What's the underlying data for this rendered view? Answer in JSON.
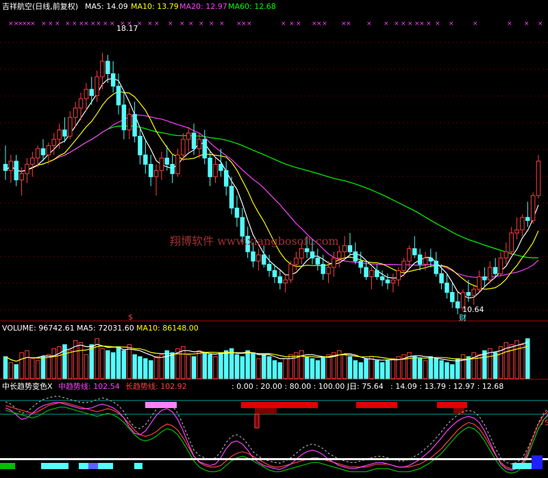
{
  "header": {
    "title": "吉祥航空(日线,前复权)",
    "ma5_label": "MA5: 14.09",
    "ma10_label": "MA10: 13.79",
    "ma20_label": "MA20: 12.97",
    "ma60_label": "MA60: 12.68"
  },
  "annotations": {
    "high": "18.17",
    "low": "10.64",
    "low_marker": "财",
    "dollar_marker": "$",
    "watermark": "翔博软件 www.xiangbosoft.com"
  },
  "volume_header": {
    "volume_label": "VOLUME: 96742.61",
    "ma5_label": "MA5: 72031.60",
    "ma10_label": "MA10: 86148.00"
  },
  "indicator_header": {
    "name": "中长趋势变色X",
    "mid_label": "中趋势线: 102.54",
    "long_label": "长趋势线: 102.92",
    "extra": ": 0.00 : 20.00 : 80.00 : 100.00 J日: 75.64",
    "ma_values": ": 14.09 : 13.79 : 12.97 : 12.68"
  },
  "indicator_edge_label": "75",
  "colors": {
    "background": "#000000",
    "up": "#ff4040",
    "down": "#54fcfc",
    "ma5": "#ffffff",
    "ma10": "#ffff00",
    "ma20": "#ff40ff",
    "ma60": "#00ff00",
    "separator": "#c00000",
    "header_text": "#ffffff",
    "mid_trend": "#ff40ff",
    "long_trend": "#ff4040"
  },
  "chart_data": [
    {
      "type": "candlestick",
      "panel": "price",
      "ylim": [
        10.2,
        19.2
      ],
      "high_marker": 18.17,
      "low_marker": 10.64,
      "candles": [
        [
          14.6,
          15.2,
          14.1,
          14.4
        ],
        [
          14.4,
          14.9,
          14.0,
          14.7
        ],
        [
          14.7,
          14.9,
          13.9,
          14.1
        ],
        [
          14.1,
          14.5,
          13.6,
          14.3
        ],
        [
          14.3,
          14.8,
          14.0,
          14.6
        ],
        [
          14.6,
          15.0,
          14.2,
          14.8
        ],
        [
          14.8,
          15.2,
          14.5,
          15.1
        ],
        [
          15.1,
          15.4,
          14.7,
          14.9
        ],
        [
          14.9,
          15.3,
          14.6,
          15.2
        ],
        [
          15.2,
          15.6,
          14.9,
          15.4
        ],
        [
          15.4,
          15.9,
          15.1,
          15.7
        ],
        [
          15.7,
          16.1,
          15.3,
          15.5
        ],
        [
          15.5,
          16.3,
          15.4,
          16.1
        ],
        [
          16.1,
          16.6,
          15.8,
          16.4
        ],
        [
          16.4,
          16.9,
          16.0,
          16.7
        ],
        [
          16.7,
          17.2,
          16.3,
          17.0
        ],
        [
          17.0,
          17.4,
          16.5,
          16.8
        ],
        [
          16.8,
          17.6,
          16.6,
          17.4
        ],
        [
          17.4,
          18.17,
          17.0,
          17.9
        ],
        [
          17.9,
          18.1,
          17.2,
          17.5
        ],
        [
          17.5,
          17.9,
          16.9,
          17.1
        ],
        [
          17.1,
          17.5,
          16.2,
          16.5
        ],
        [
          16.5,
          16.9,
          15.4,
          15.7
        ],
        [
          15.7,
          16.4,
          15.4,
          16.2
        ],
        [
          16.2,
          16.6,
          15.3,
          15.5
        ],
        [
          15.5,
          15.8,
          14.6,
          14.9
        ],
        [
          14.9,
          15.4,
          14.3,
          14.6
        ],
        [
          14.6,
          14.9,
          13.9,
          14.2
        ],
        [
          14.2,
          14.6,
          13.6,
          14.4
        ],
        [
          14.4,
          15.0,
          14.1,
          14.8
        ],
        [
          14.8,
          15.2,
          14.4,
          14.6
        ],
        [
          14.6,
          14.9,
          14.0,
          14.3
        ],
        [
          14.3,
          15.1,
          14.2,
          14.9
        ],
        [
          14.9,
          15.6,
          14.7,
          15.4
        ],
        [
          15.4,
          15.8,
          15.0,
          15.6
        ],
        [
          15.6,
          15.9,
          14.9,
          15.1
        ],
        [
          15.1,
          15.6,
          14.8,
          15.4
        ],
        [
          15.4,
          15.7,
          14.6,
          14.8
        ],
        [
          14.8,
          15.0,
          13.9,
          14.2
        ],
        [
          14.2,
          14.8,
          14.0,
          14.6
        ],
        [
          14.6,
          15.1,
          14.2,
          14.4
        ],
        [
          14.4,
          14.7,
          13.6,
          13.9
        ],
        [
          13.9,
          14.2,
          13.0,
          13.2
        ],
        [
          13.2,
          13.6,
          12.6,
          12.9
        ],
        [
          12.9,
          13.2,
          12.1,
          12.3
        ],
        [
          12.3,
          12.6,
          11.6,
          11.8
        ],
        [
          11.8,
          12.1,
          11.3,
          11.5
        ],
        [
          11.5,
          11.9,
          11.2,
          11.7
        ],
        [
          11.7,
          12.0,
          11.3,
          11.4
        ],
        [
          11.4,
          11.7,
          11.0,
          11.2
        ],
        [
          11.2,
          11.4,
          10.8,
          11.0
        ],
        [
          11.0,
          11.2,
          10.6,
          10.8
        ],
        [
          10.8,
          11.1,
          10.5,
          10.9
        ],
        [
          10.9,
          11.5,
          10.8,
          11.4
        ],
        [
          11.4,
          11.8,
          11.2,
          11.6
        ],
        [
          11.6,
          12.1,
          11.4,
          11.9
        ],
        [
          11.9,
          12.3,
          11.6,
          11.8
        ],
        [
          11.8,
          12.2,
          11.4,
          11.6
        ],
        [
          11.6,
          11.9,
          11.2,
          11.4
        ],
        [
          11.4,
          11.7,
          10.9,
          11.1
        ],
        [
          11.1,
          11.5,
          10.8,
          11.3
        ],
        [
          11.3,
          11.8,
          11.0,
          11.6
        ],
        [
          11.6,
          12.0,
          11.3,
          11.8
        ],
        [
          11.8,
          12.3,
          11.6,
          12.0
        ],
        [
          12.0,
          12.4,
          11.7,
          11.8
        ],
        [
          11.8,
          12.1,
          11.4,
          11.5
        ],
        [
          11.5,
          11.8,
          11.1,
          11.3
        ],
        [
          11.3,
          11.5,
          10.9,
          11.0
        ],
        [
          11.0,
          11.3,
          10.6,
          11.2
        ],
        [
          11.2,
          11.4,
          10.9,
          11.0
        ],
        [
          11.0,
          11.2,
          10.7,
          10.9
        ],
        [
          10.9,
          11.1,
          10.6,
          10.8
        ],
        [
          10.8,
          11.1,
          10.5,
          10.9
        ],
        [
          10.9,
          11.3,
          10.7,
          11.2
        ],
        [
          11.2,
          11.6,
          11.0,
          11.5
        ],
        [
          11.5,
          12.0,
          11.3,
          11.9
        ],
        [
          11.9,
          12.3,
          11.6,
          11.7
        ],
        [
          11.7,
          11.9,
          11.2,
          11.4
        ],
        [
          11.4,
          11.8,
          11.2,
          11.6
        ],
        [
          11.6,
          11.9,
          11.3,
          11.5
        ],
        [
          11.5,
          11.8,
          11.0,
          11.1
        ],
        [
          11.1,
          11.4,
          10.6,
          10.8
        ],
        [
          10.8,
          11.1,
          10.3,
          10.5
        ],
        [
          10.5,
          10.8,
          10.0,
          10.2
        ],
        [
          10.2,
          10.5,
          9.8,
          10.0
        ],
        [
          10.0,
          10.6,
          9.9,
          10.5
        ],
        [
          10.5,
          10.9,
          10.2,
          10.4
        ],
        [
          10.4,
          10.7,
          10.1,
          10.6
        ],
        [
          10.6,
          11.2,
          10.5,
          11.0
        ],
        [
          11.0,
          11.3,
          10.7,
          10.9
        ],
        [
          10.9,
          11.5,
          10.8,
          11.3
        ],
        [
          11.3,
          11.6,
          11.0,
          11.1
        ],
        [
          11.1,
          11.8,
          11.0,
          11.6
        ],
        [
          11.6,
          12.1,
          11.4,
          11.8
        ],
        [
          11.8,
          12.6,
          11.7,
          12.4
        ],
        [
          12.4,
          12.9,
          12.2,
          12.5
        ],
        [
          12.5,
          13.0,
          12.3,
          12.9
        ],
        [
          12.9,
          13.4,
          12.6,
          12.8
        ],
        [
          12.8,
          13.7,
          12.7,
          13.6
        ],
        [
          13.6,
          14.9,
          13.5,
          14.7
        ]
      ],
      "title": "",
      "xlabel": "",
      "ylabel": ""
    },
    {
      "type": "bar",
      "panel": "volume",
      "values": [
        55,
        40,
        35,
        65,
        70,
        50,
        45,
        55,
        60,
        75,
        80,
        85,
        70,
        95,
        90,
        60,
        85,
        100,
        75,
        70,
        65,
        80,
        70,
        85,
        60,
        55,
        50,
        45,
        55,
        60,
        70,
        65,
        75,
        80,
        60,
        55,
        70,
        65,
        60,
        55,
        65,
        70,
        75,
        60,
        55,
        70,
        65,
        50,
        60,
        55,
        45,
        40,
        50,
        60,
        65,
        70,
        55,
        50,
        45,
        55,
        60,
        65,
        70,
        60,
        55,
        45,
        40,
        50,
        55,
        45,
        40,
        45,
        50,
        55,
        60,
        65,
        55,
        50,
        45,
        55,
        50,
        45,
        40,
        35,
        50,
        60,
        55,
        65,
        60,
        70,
        75,
        65,
        80,
        90,
        85,
        95,
        85,
        100
      ],
      "ylim": [
        0,
        110
      ],
      "title": "",
      "xlabel": "",
      "ylabel": ""
    },
    {
      "type": "line",
      "panel": "indicator",
      "ylim": [
        0,
        100
      ],
      "series": [
        {
          "name": "中趋势线",
          "values": [
            85,
            82,
            76,
            70,
            72,
            78,
            84,
            88,
            90,
            92,
            92,
            90,
            88,
            86,
            84,
            84,
            85,
            88,
            90,
            88,
            85,
            80,
            72,
            60,
            52,
            50,
            55,
            65,
            75,
            82,
            84,
            80,
            70,
            55,
            38,
            22,
            15,
            12,
            10,
            12,
            20,
            32,
            40,
            42,
            38,
            30,
            20,
            14,
            10,
            8,
            6,
            5,
            8,
            12,
            18,
            24,
            28,
            30,
            28,
            24,
            18,
            14,
            10,
            8,
            6,
            6,
            8,
            10,
            12,
            14,
            14,
            12,
            10,
            8,
            8,
            10,
            14,
            18,
            24,
            30,
            38,
            46,
            55,
            62,
            68,
            72,
            74,
            72,
            66,
            55,
            40,
            25,
            12,
            6,
            4,
            6,
            12,
            24,
            40,
            58,
            70,
            78,
            82,
            80,
            78,
            80
          ]
        },
        {
          "name": "长趋势线",
          "values": [
            88,
            86,
            84,
            82,
            80,
            78,
            80,
            84,
            88,
            90,
            92,
            92,
            90,
            88,
            86,
            84,
            82,
            80,
            82,
            84,
            82,
            78,
            72,
            64,
            56,
            50,
            48,
            50,
            54,
            60,
            64,
            62,
            56,
            46,
            34,
            22,
            14,
            10,
            8,
            8,
            10,
            16,
            22,
            26,
            28,
            26,
            22,
            18,
            14,
            10,
            8,
            8,
            10,
            12,
            14,
            16,
            18,
            20,
            20,
            18,
            16,
            14,
            12,
            10,
            8,
            8,
            8,
            8,
            10,
            12,
            12,
            12,
            10,
            8,
            8,
            8,
            10,
            12,
            16,
            20,
            26,
            32,
            40,
            48,
            56,
            62,
            66,
            64,
            58,
            48,
            36,
            24,
            14,
            8,
            6,
            8,
            14,
            28,
            46,
            64,
            76,
            82,
            84,
            82,
            80,
            82
          ]
        }
      ],
      "title": "",
      "xlabel": "",
      "ylabel": ""
    }
  ]
}
